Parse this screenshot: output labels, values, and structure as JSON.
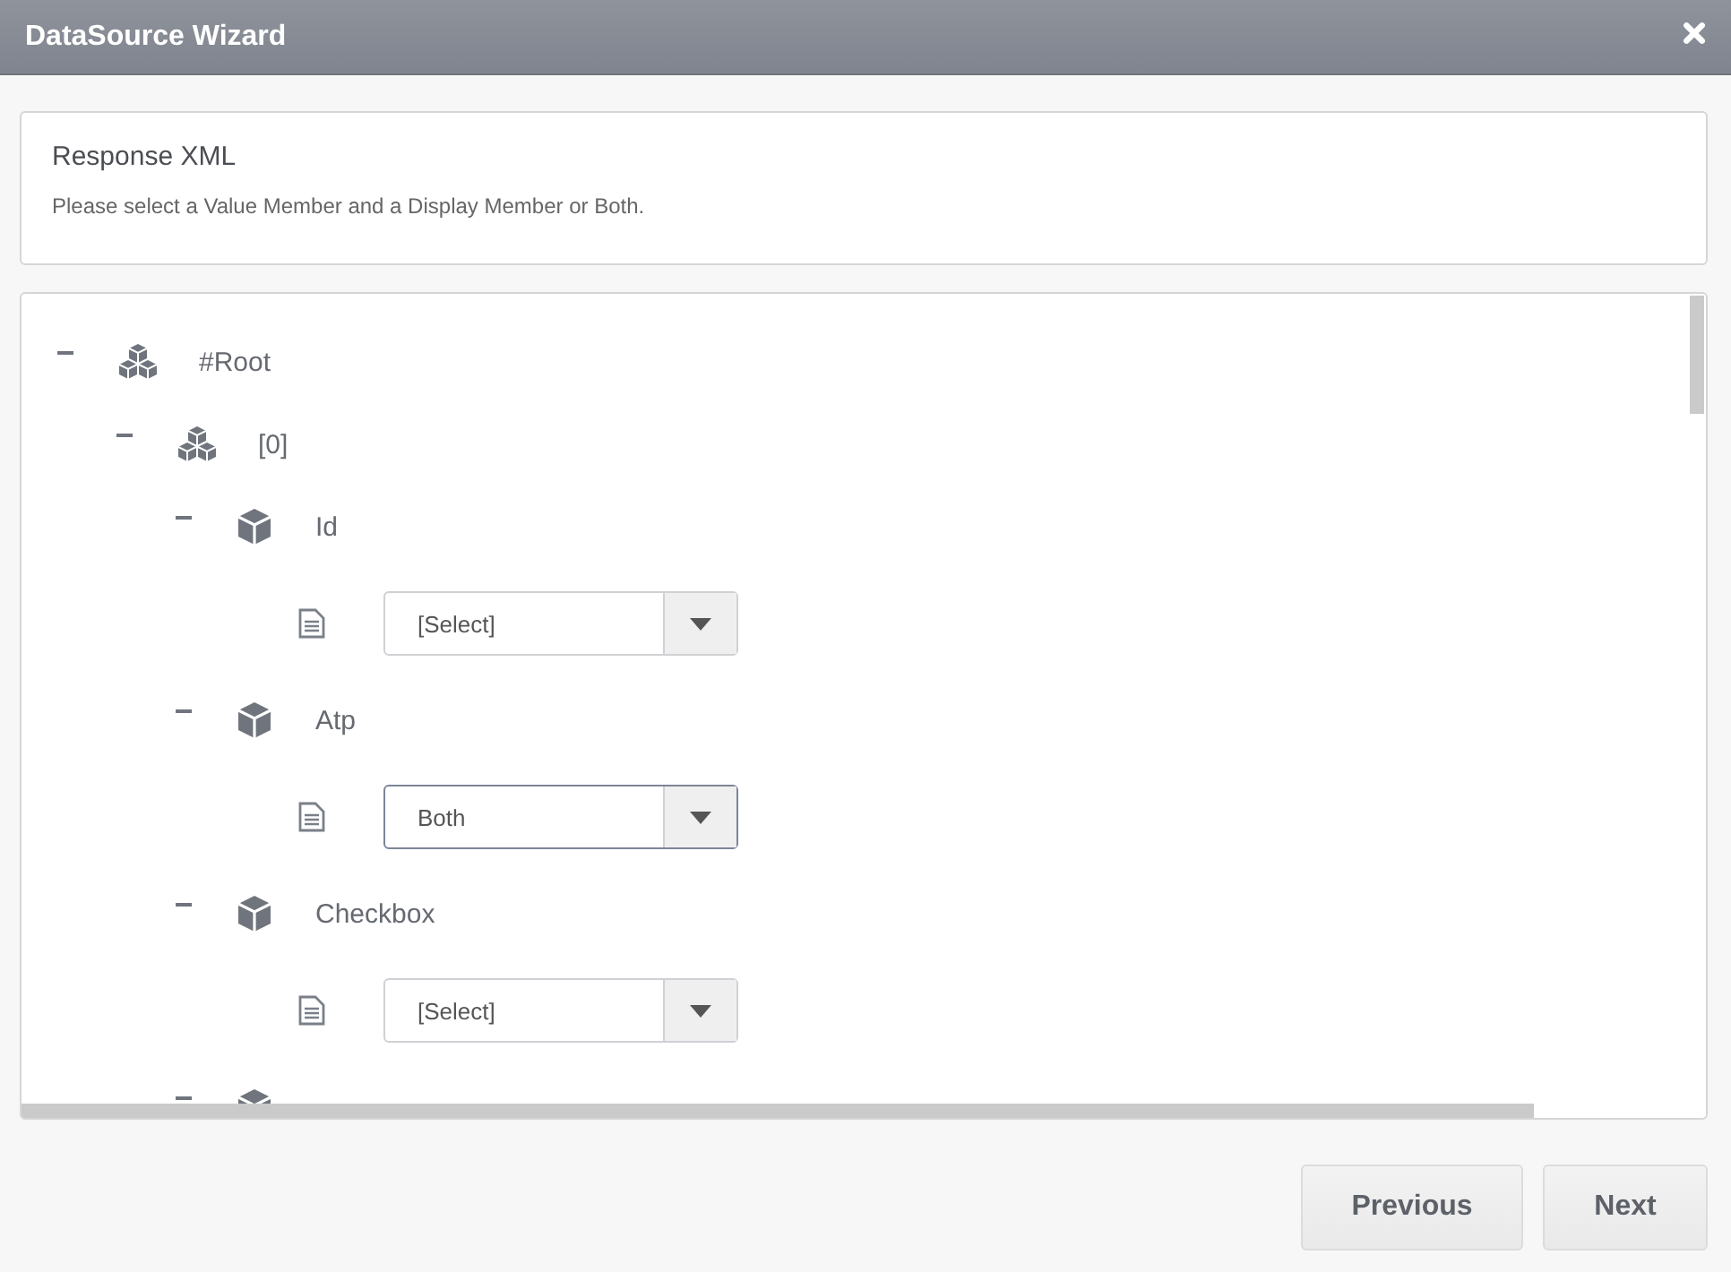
{
  "window": {
    "title": "DataSource Wizard"
  },
  "header": {
    "title": "Response XML",
    "description": "Please select a Value Member and a Display Member or Both."
  },
  "tree": [
    {
      "kind": "group",
      "label": "#Root",
      "expanded": true,
      "children": [
        {
          "kind": "group",
          "label": "[0]",
          "expanded": true,
          "children": [
            {
              "kind": "item",
              "label": "Id",
              "expanded": true,
              "children": [
                {
                  "kind": "field",
                  "value": "[Select]",
                  "focused": false
                }
              ]
            },
            {
              "kind": "item",
              "label": "Atp",
              "expanded": true,
              "children": [
                {
                  "kind": "field",
                  "value": "Both",
                  "focused": true
                }
              ]
            },
            {
              "kind": "item",
              "label": "Checkbox",
              "expanded": true,
              "children": [
                {
                  "kind": "field",
                  "value": "[Select]",
                  "focused": false
                }
              ]
            },
            {
              "kind": "item",
              "expanded": true
            }
          ]
        }
      ]
    }
  ],
  "buttons": [
    {
      "label": "Previous"
    },
    {
      "label": "Next"
    }
  ]
}
